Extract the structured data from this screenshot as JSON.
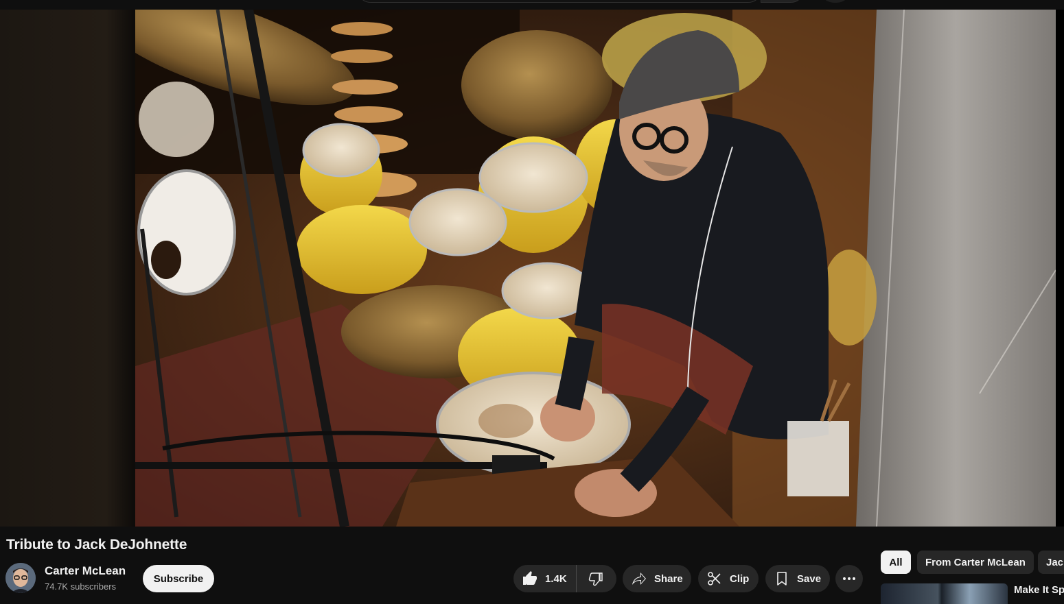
{
  "video": {
    "title": "Tribute to Jack DeJohnette"
  },
  "channel": {
    "name": "Carter McLean",
    "subscribers": "74.7K subscribers",
    "subscribe_label": "Subscribe"
  },
  "actions": {
    "like_count": "1.4K",
    "share_label": "Share",
    "clip_label": "Clip",
    "save_label": "Save"
  },
  "chips": {
    "all": "All",
    "from_channel": "From Carter McLean",
    "partial": "Jac"
  },
  "recommendation": {
    "title_partial": "Make It Sp"
  },
  "icons": {
    "like": "thumbs-up-icon",
    "dislike": "thumbs-down-icon",
    "share": "share-arrow-icon",
    "clip": "scissors-icon",
    "save": "bookmark-icon",
    "more": "more-horizontal-icon"
  },
  "colors": {
    "background": "#0f0f0f",
    "pill": "#272727",
    "text": "#f1f1f1",
    "secondary_text": "#aaaaaa"
  }
}
